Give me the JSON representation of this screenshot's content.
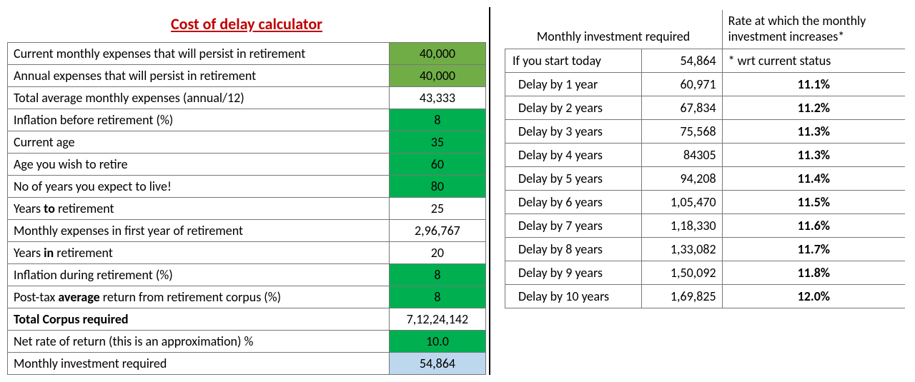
{
  "title": "Cost of delay calculator",
  "left_rows": [
    {
      "label_html": "Current monthly expenses that will persist in retirement",
      "value": "40,000",
      "cls": "green1"
    },
    {
      "label_html": "Annual expenses that will persist in retirement",
      "value": "40,000",
      "cls": "green1"
    },
    {
      "label_html": "Total average monthly expenses (annual/12)",
      "value": "43,333",
      "cls": ""
    },
    {
      "label_html": "Inflation before retirement (%)",
      "value": "8",
      "cls": "green2"
    },
    {
      "label_html": "Current age",
      "value": "35",
      "cls": "green2"
    },
    {
      "label_html": "Age you wish to retire",
      "value": "60",
      "cls": "green2"
    },
    {
      "label_html": "No of years you expect to live!",
      "value": "80",
      "cls": "green2"
    },
    {
      "label_html": "Years <b>to</b> retirement",
      "value": "25",
      "cls": ""
    },
    {
      "label_html": "Monthly expenses in first year of retirement",
      "value": "2,96,767",
      "cls": ""
    },
    {
      "label_html": "Years <b>in</b> retirement",
      "value": "20",
      "cls": ""
    },
    {
      "label_html": "Inflation during retirement (%)",
      "value": "8",
      "cls": "green2"
    },
    {
      "label_html": "Post-tax <b>average</b> return from retirement corpus (%)",
      "value": "8",
      "cls": "green2"
    },
    {
      "label_html": "<b>Total Corpus required</b>",
      "value": "7,12,24,142",
      "cls": ""
    },
    {
      "label_html": "Net rate of return (this is an approximation) %",
      "value": "10.0",
      "cls": "green2"
    },
    {
      "label_html": "Monthly investment required",
      "value": "54,864",
      "cls": "blue1"
    }
  ],
  "right_header": {
    "col1": "Monthly investment required",
    "col2": "Rate at which the monthly investment increases*"
  },
  "right_first_row": {
    "label": "If you start today",
    "amount": "54,864",
    "note": "* wrt current status"
  },
  "right_rows": [
    {
      "label": "Delay by 1 year",
      "amount": "60,971",
      "rate": "11.1%"
    },
    {
      "label": "Delay by 2 years",
      "amount": "67,834",
      "rate": "11.2%"
    },
    {
      "label": "Delay by 3 years",
      "amount": "75,568",
      "rate": "11.3%"
    },
    {
      "label": "Delay by 4 years",
      "amount": "84305",
      "rate": "11.3%"
    },
    {
      "label": "Delay by 5 years",
      "amount": "94,208",
      "rate": "11.4%"
    },
    {
      "label": "Delay by 6 years",
      "amount": "1,05,470",
      "rate": "11.5%"
    },
    {
      "label": "Delay by 7 years",
      "amount": "1,18,330",
      "rate": "11.6%"
    },
    {
      "label": "Delay by 8 years",
      "amount": "1,33,082",
      "rate": "11.7%"
    },
    {
      "label": "Delay by 9 years",
      "amount": "1,50,092",
      "rate": "11.8%"
    },
    {
      "label": "Delay by 10 years",
      "amount": "1,69,825",
      "rate": "12.0%"
    }
  ]
}
